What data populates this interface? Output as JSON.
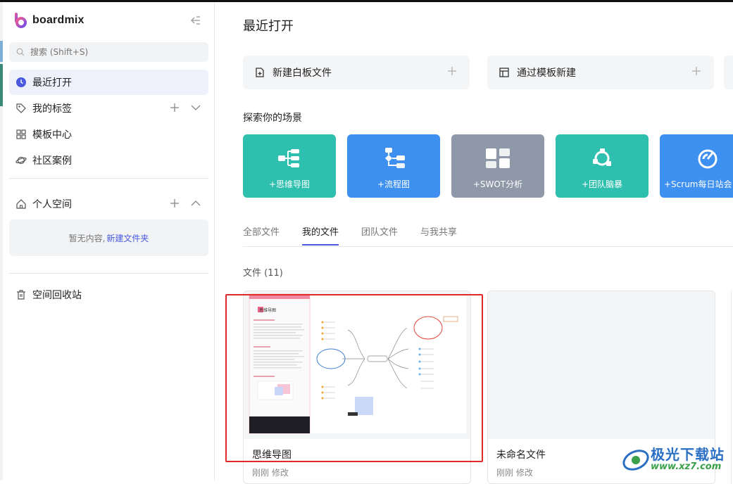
{
  "app": {
    "name": "boardmix",
    "brand_color": "#4a59e0"
  },
  "sidebar": {
    "search_placeholder": "搜索 (Shift+S)",
    "items": [
      {
        "label": "最近打开",
        "icon": "clock-icon",
        "active": true
      },
      {
        "label": "我的标签",
        "icon": "tag-icon"
      },
      {
        "label": "模板中心",
        "icon": "grid-icon"
      },
      {
        "label": "社区案例",
        "icon": "planet-icon"
      }
    ],
    "personal_space": {
      "label": "个人空间",
      "empty_text": "暂无内容,",
      "empty_link": "新建文件夹"
    },
    "trash": {
      "label": "空间回收站"
    }
  },
  "main": {
    "title": "最近打开",
    "actions": [
      {
        "label": "新建白板文件"
      },
      {
        "label": "通过模板新建"
      }
    ],
    "scenes_title": "探索你的场景",
    "scenes": [
      {
        "label": "+思维导图",
        "color": "#2fbfae",
        "icon": "mindmap-icon"
      },
      {
        "label": "+流程图",
        "color": "#3d8ff0",
        "icon": "flowchart-icon"
      },
      {
        "label": "+SWOT分析",
        "color": "#8f98a8",
        "icon": "swot-icon"
      },
      {
        "label": "+团队脑暴",
        "color": "#2fbfae",
        "icon": "brainstorm-icon"
      },
      {
        "label": "+Scrum每日站会",
        "color": "#3d8ff0",
        "icon": "scrum-icon"
      }
    ],
    "tabs": [
      {
        "label": "全部文件"
      },
      {
        "label": "我的文件",
        "active": true
      },
      {
        "label": "团队文件"
      },
      {
        "label": "与我共享"
      }
    ],
    "files_label": "文件 (11)",
    "files": [
      {
        "name": "思维导图",
        "meta": "刚刚 修改",
        "thumb_title": "思维导图"
      },
      {
        "name": "未命名文件",
        "meta": "刚刚 修改"
      }
    ]
  },
  "watermark": {
    "line1": "极光下载站",
    "line2": "www.xz7.com"
  }
}
